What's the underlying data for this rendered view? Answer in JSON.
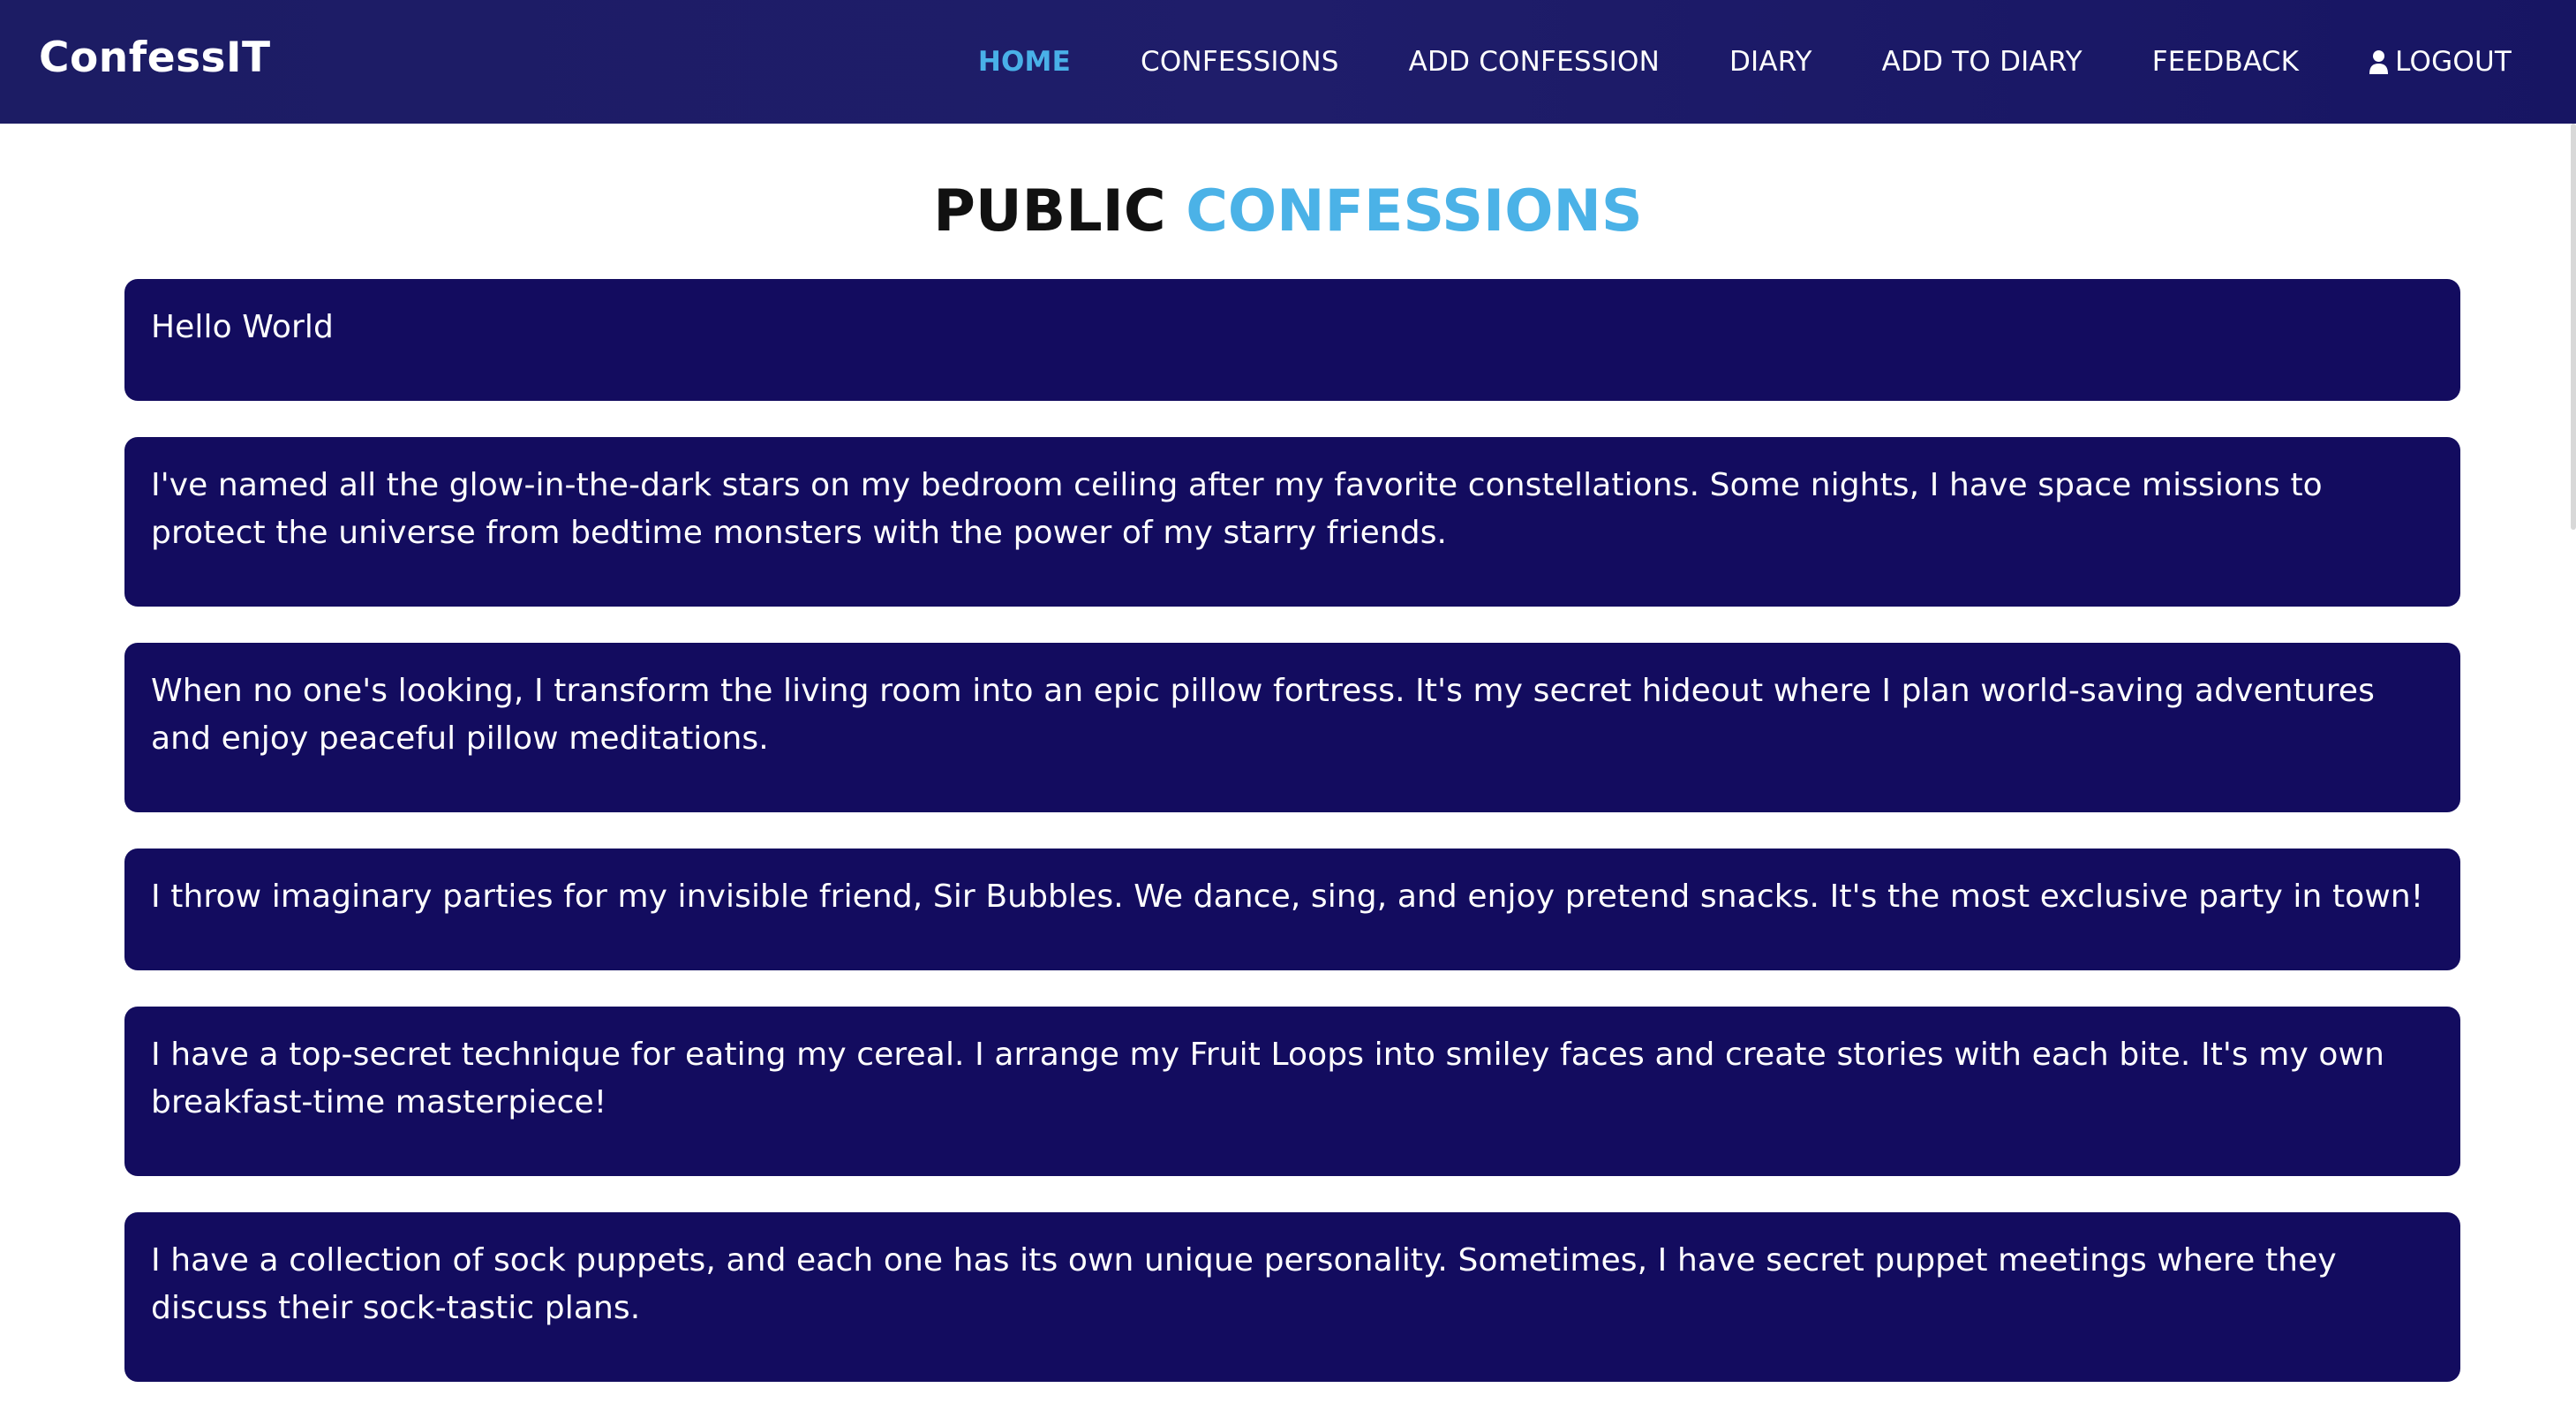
{
  "app": {
    "brand": "ConfessIT"
  },
  "nav": {
    "home": "HOME",
    "confessions": "CONFESSIONS",
    "add_confession": "ADD CONFESSION",
    "diary": "DIARY",
    "add_to_diary": "ADD TO DIARY",
    "feedback": "FEEDBACK",
    "logout": "LOGOUT",
    "logout_icon": "user-icon",
    "active_color": "#49b0e8"
  },
  "page": {
    "title_part1": "PUBLIC",
    "title_part2": "CONFESSIONS",
    "accent_color": "#4bb2e7"
  },
  "confessions": [
    {
      "text": "Hello World"
    },
    {
      "text": "I've named all the glow-in-the-dark stars on my bedroom ceiling after my favorite constellations. Some nights, I have space missions to protect the universe from bedtime monsters with the power of my starry friends."
    },
    {
      "text": "When no one's looking, I transform the living room into an epic pillow fortress. It's my secret hideout where I plan world-saving adventures and enjoy peaceful pillow meditations."
    },
    {
      "text": "I throw imaginary parties for my invisible friend, Sir Bubbles. We dance, sing, and enjoy pretend snacks. It's the most exclusive party in town!"
    },
    {
      "text": "I have a top-secret technique for eating my cereal. I arrange my Fruit Loops into smiley faces and create stories with each bite. It's my own breakfast-time masterpiece!"
    },
    {
      "text": "I have a collection of sock puppets, and each one has its own unique personality. Sometimes, I have secret puppet meetings where they discuss their sock-tastic plans."
    }
  ],
  "colors": {
    "navbar_bg": "#1c1c64",
    "card_bg": "#130c5f",
    "card_text": "#ffffff"
  }
}
